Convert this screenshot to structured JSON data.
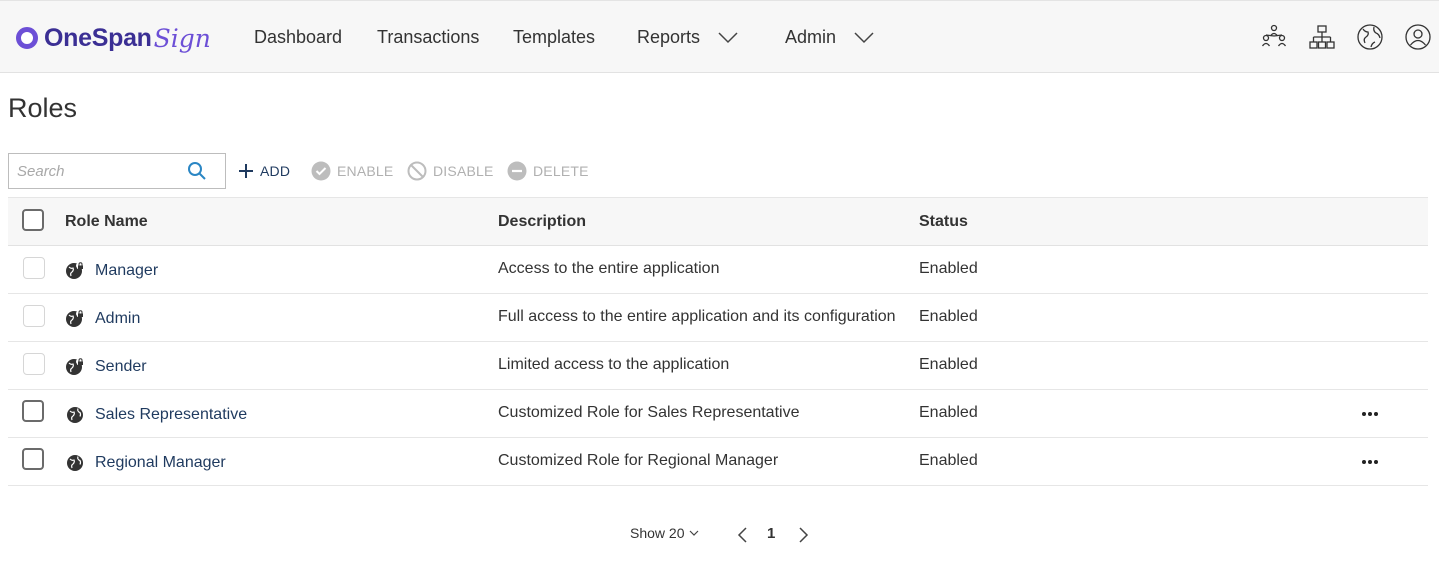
{
  "brand": {
    "name": "OneSpan",
    "script": "Sign"
  },
  "nav": {
    "dashboard": "Dashboard",
    "transactions": "Transactions",
    "templates": "Templates",
    "reports": "Reports",
    "admin": "Admin"
  },
  "header_icons": [
    "team-icon",
    "org-chart-icon",
    "globe-icon",
    "user-icon"
  ],
  "page": {
    "title": "Roles"
  },
  "search": {
    "placeholder": "Search",
    "value": ""
  },
  "toolbar": {
    "add_label": "ADD",
    "enable_label": "ENABLE",
    "disable_label": "DISABLE",
    "delete_label": "DELETE"
  },
  "table": {
    "columns": {
      "name": "Role Name",
      "description": "Description",
      "status": "Status"
    },
    "rows": [
      {
        "name": "Manager",
        "description": "Access to the entire application",
        "status": "Enabled",
        "system": true
      },
      {
        "name": "Admin",
        "description": "Full access to the entire application and its configuration",
        "status": "Enabled",
        "system": true
      },
      {
        "name": "Sender",
        "description": "Limited access to the application",
        "status": "Enabled",
        "system": true
      },
      {
        "name": "Sales Representative",
        "description": "Customized Role for Sales Representative",
        "status": "Enabled",
        "system": false
      },
      {
        "name": "Regional Manager",
        "description": "Customized Role for Regional Manager",
        "status": "Enabled",
        "system": false
      }
    ]
  },
  "pagination": {
    "show_label": "Show 20",
    "current_page": "1"
  },
  "colors": {
    "brand": "#6c4fd6",
    "brand_dark": "#3b2f94",
    "link": "#1f3a5f",
    "disabled": "#b0b0b0"
  }
}
